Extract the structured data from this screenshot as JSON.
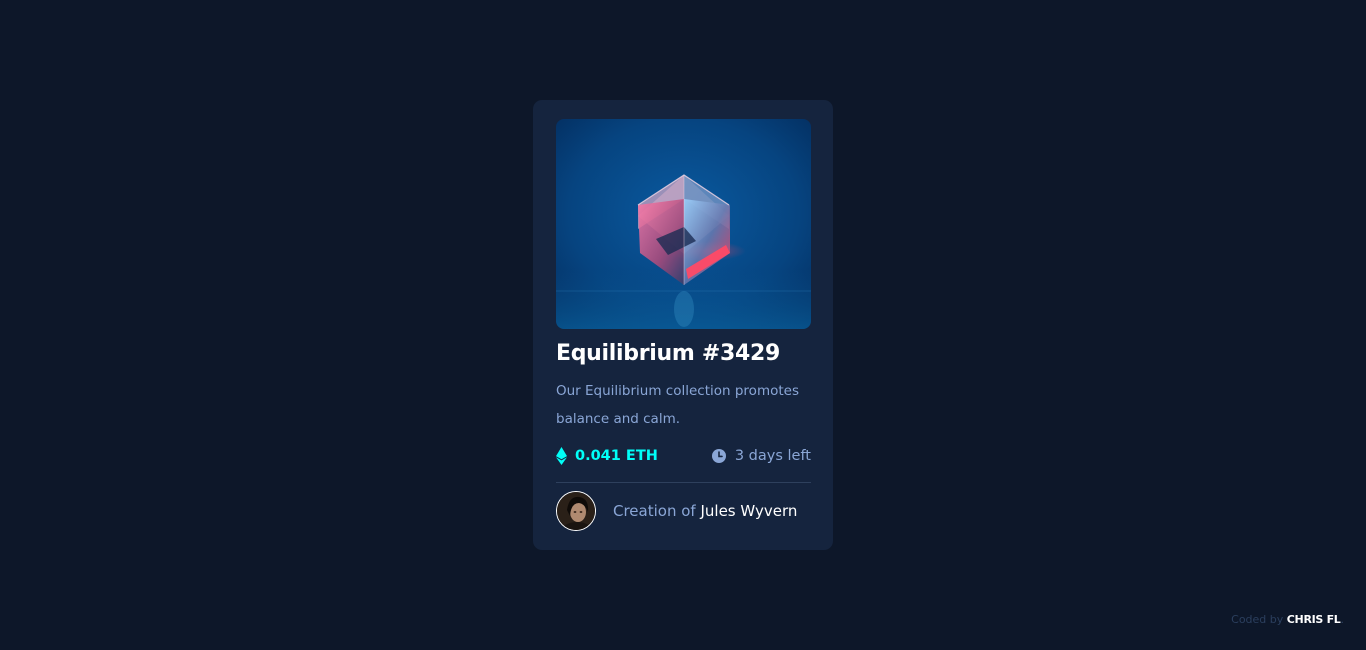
{
  "card": {
    "image_alt": "Equilibrium",
    "title": "Equilibrium #3429",
    "description_line1": "Our Equilibrium collection promotes",
    "description_line2": "balance and calm.",
    "price": "0.041 ETH",
    "time_left": "3 days left",
    "creator_prefix": "Creation of",
    "creator_name": "Jules Wyvern"
  },
  "footer": {
    "prefix": "Coded by",
    "author": "CHRIS FL"
  },
  "icons": {
    "price": "ethereum-icon",
    "time": "clock-icon"
  },
  "colors": {
    "page_bg": "#0d1729",
    "card_bg": "#15243e",
    "cyan": "#00fff8",
    "soft_blue": "#8aa6d6",
    "white": "#ffffff"
  }
}
